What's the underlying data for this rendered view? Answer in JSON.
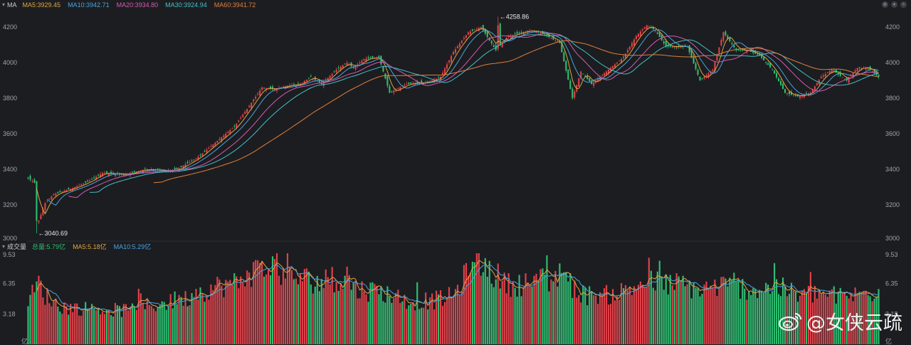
{
  "top_legend": {
    "title": "MA",
    "items": [
      {
        "text": "MA5:3929.45",
        "color": "#e0a640"
      },
      {
        "text": "MA10:3942.71",
        "color": "#4aa3df"
      },
      {
        "text": "MA20:3934.80",
        "color": "#d65bb0"
      },
      {
        "text": "MA30:3924.94",
        "color": "#43c0c8"
      },
      {
        "text": "MA60:3941.72",
        "color": "#e0803a"
      }
    ]
  },
  "volume_legend": {
    "title": "成交量",
    "items": [
      {
        "text": "总量:5.79亿",
        "color": "#2fbf71"
      },
      {
        "text": "MA5:5.18亿",
        "color": "#e0a640"
      },
      {
        "text": "MA10:5.29亿",
        "color": "#4aa3df"
      }
    ]
  },
  "watermark": {
    "text": "@女侠云疏",
    "icon": "weibo-logo-icon"
  },
  "window_icons": [
    "gear-icon",
    "chevron-down-icon",
    "close-icon"
  ],
  "chart_data": [
    {
      "type": "candlestick",
      "y_ticks": [
        "4200",
        "4000",
        "3800",
        "3600",
        "3400",
        "3200",
        "3000"
      ],
      "ylim": [
        3000,
        4300
      ],
      "annotations": [
        {
          "text": "←3040.69",
          "index": 4,
          "value": 3040.69
        },
        {
          "text": "←4258.86",
          "index": 221,
          "value": 4258.86
        }
      ],
      "colors": {
        "up": "#e0424a",
        "down": "#2fbf71"
      },
      "close_anchors": [
        [
          0,
          3350
        ],
        [
          3,
          3325
        ],
        [
          5,
          3110
        ],
        [
          8,
          3210
        ],
        [
          12,
          3260
        ],
        [
          20,
          3290
        ],
        [
          28,
          3330
        ],
        [
          35,
          3380
        ],
        [
          45,
          3370
        ],
        [
          55,
          3400
        ],
        [
          65,
          3390
        ],
        [
          70,
          3400
        ],
        [
          80,
          3470
        ],
        [
          90,
          3570
        ],
        [
          97,
          3640
        ],
        [
          103,
          3740
        ],
        [
          110,
          3860
        ],
        [
          115,
          3850
        ],
        [
          122,
          3870
        ],
        [
          128,
          3880
        ],
        [
          133,
          3920
        ],
        [
          138,
          3880
        ],
        [
          145,
          3960
        ],
        [
          150,
          4000
        ],
        [
          153,
          3970
        ],
        [
          158,
          4020
        ],
        [
          165,
          4030
        ],
        [
          170,
          3830
        ],
        [
          178,
          3880
        ],
        [
          188,
          3890
        ],
        [
          194,
          3920
        ],
        [
          200,
          4060
        ],
        [
          207,
          4170
        ],
        [
          213,
          4200
        ],
        [
          220,
          4070
        ],
        [
          226,
          4150
        ],
        [
          235,
          4180
        ],
        [
          241,
          4170
        ],
        [
          250,
          4110
        ],
        [
          256,
          3800
        ],
        [
          260,
          3950
        ],
        [
          265,
          3880
        ],
        [
          272,
          3950
        ],
        [
          280,
          4030
        ],
        [
          286,
          4150
        ],
        [
          291,
          4210
        ],
        [
          295,
          4180
        ],
        [
          300,
          4090
        ],
        [
          306,
          4090
        ],
        [
          310,
          4090
        ],
        [
          316,
          3900
        ],
        [
          322,
          3960
        ],
        [
          327,
          4170
        ],
        [
          333,
          4070
        ],
        [
          338,
          4070
        ],
        [
          344,
          4040
        ],
        [
          350,
          3960
        ],
        [
          356,
          3830
        ],
        [
          362,
          3810
        ],
        [
          368,
          3830
        ],
        [
          373,
          3920
        ],
        [
          378,
          3960
        ],
        [
          385,
          3900
        ],
        [
          390,
          3970
        ],
        [
          395,
          3970
        ],
        [
          398,
          3940
        ],
        [
          400,
          3920
        ]
      ],
      "ma_series": [
        {
          "name": "MA5",
          "period": 5,
          "color": "#e0a640"
        },
        {
          "name": "MA10",
          "period": 10,
          "color": "#4aa3df"
        },
        {
          "name": "MA20",
          "period": 20,
          "color": "#d65bb0"
        },
        {
          "name": "MA30",
          "period": 30,
          "color": "#43c0c8"
        },
        {
          "name": "MA60",
          "period": 60,
          "color": "#e0803a"
        }
      ]
    },
    {
      "type": "bar",
      "y_ticks": [
        "9.53",
        "6.35",
        "3.18"
      ],
      "unit_label": "亿",
      "ylim": [
        0,
        9.53
      ],
      "volume_anchors": [
        [
          0,
          4.5
        ],
        [
          5,
          6.5
        ],
        [
          8,
          5.2
        ],
        [
          15,
          4.0
        ],
        [
          30,
          3.7
        ],
        [
          45,
          3.6
        ],
        [
          60,
          4.2
        ],
        [
          72,
          4.6
        ],
        [
          80,
          5.5
        ],
        [
          90,
          6.2
        ],
        [
          100,
          6.5
        ],
        [
          105,
          7.6
        ],
        [
          115,
          8.2
        ],
        [
          122,
          7.3
        ],
        [
          130,
          6.9
        ],
        [
          138,
          6.6
        ],
        [
          145,
          7.0
        ],
        [
          155,
          5.8
        ],
        [
          165,
          5.6
        ],
        [
          170,
          5.3
        ],
        [
          180,
          4.5
        ],
        [
          190,
          4.6
        ],
        [
          200,
          5.1
        ],
        [
          205,
          7.0
        ],
        [
          213,
          8.6
        ],
        [
          220,
          7.3
        ],
        [
          226,
          6.3
        ],
        [
          235,
          6.5
        ],
        [
          241,
          6.2
        ],
        [
          250,
          7.4
        ],
        [
          256,
          6.1
        ],
        [
          262,
          5.2
        ],
        [
          270,
          5.1
        ],
        [
          280,
          5.6
        ],
        [
          290,
          6.6
        ],
        [
          300,
          6.4
        ],
        [
          308,
          6.3
        ],
        [
          316,
          5.7
        ],
        [
          325,
          6.2
        ],
        [
          334,
          6.0
        ],
        [
          344,
          5.8
        ],
        [
          352,
          6.1
        ],
        [
          362,
          5.2
        ],
        [
          372,
          5.4
        ],
        [
          380,
          5.1
        ],
        [
          390,
          5.2
        ],
        [
          397,
          5.5
        ],
        [
          400,
          5.79
        ]
      ],
      "ma_series": [
        {
          "name": "MA5",
          "period": 5,
          "color": "#e0a640"
        },
        {
          "name": "MA10",
          "period": 10,
          "color": "#4aa3df"
        }
      ]
    }
  ]
}
